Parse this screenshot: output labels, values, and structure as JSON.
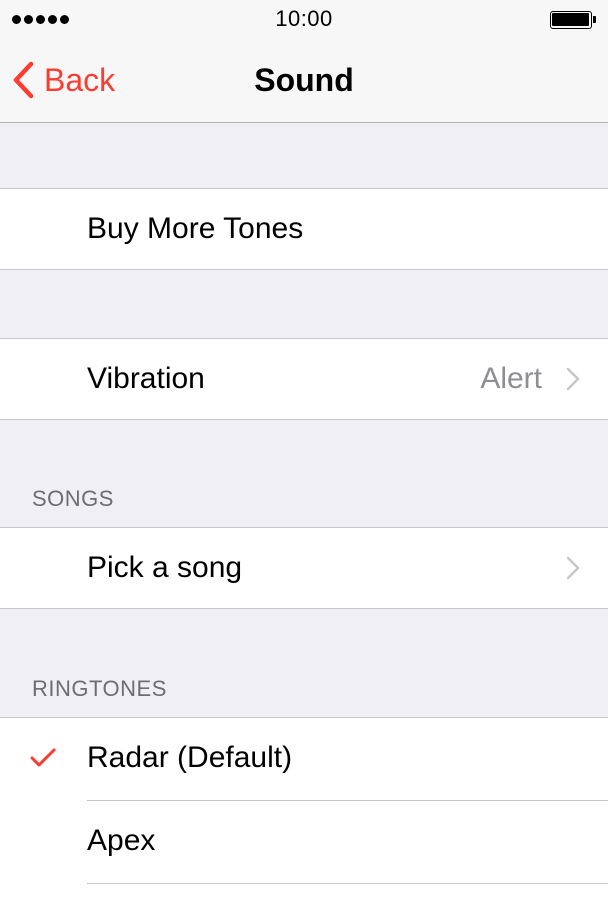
{
  "status_bar": {
    "time": "10:00"
  },
  "nav": {
    "back_label": "Back",
    "title": "Sound"
  },
  "rows": {
    "buy_more_tones": {
      "label": "Buy More Tones"
    },
    "vibration": {
      "label": "Vibration",
      "value": "Alert"
    },
    "pick_song": {
      "label": "Pick a song"
    }
  },
  "sections": {
    "songs": "SONGS",
    "ringtones": "RINGTONES"
  },
  "ringtones": [
    {
      "label": "Radar (Default)",
      "selected": true
    },
    {
      "label": "Apex",
      "selected": false
    }
  ],
  "colors": {
    "accent": "#ff3b30",
    "secondary_text": "#8e8e93",
    "group_background": "#efeff4"
  },
  "icons": {
    "back": "chevron-left-icon",
    "disclosure": "chevron-right-icon",
    "selected": "checkmark-icon",
    "battery": "battery-icon",
    "signal": "signal-dots-icon"
  }
}
